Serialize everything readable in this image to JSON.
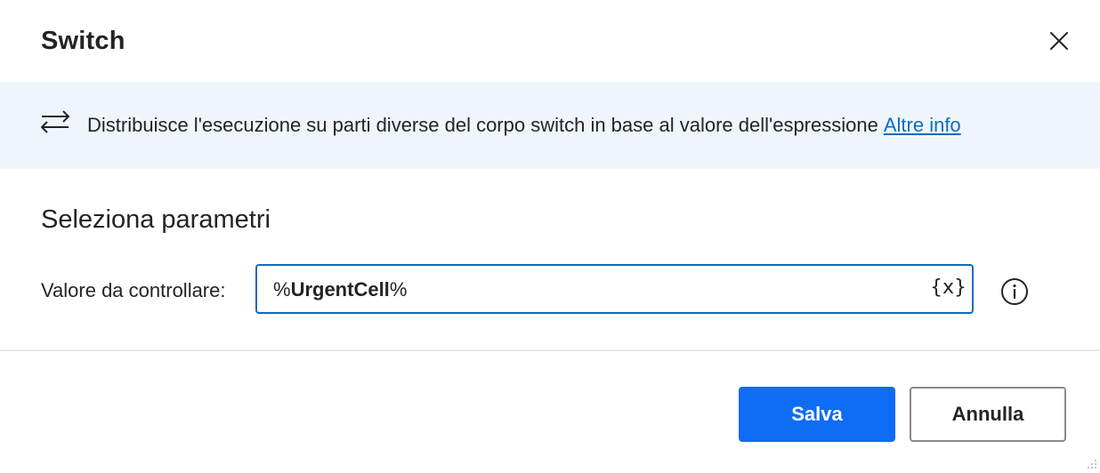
{
  "dialog": {
    "title": "Switch",
    "close_icon": "close-icon"
  },
  "banner": {
    "icon": "swap-arrows-icon",
    "description": "Distribuisce l'esecuzione su parti diverse del corpo switch in base al valore dell'espressione",
    "link_label": "Altre info"
  },
  "parameters": {
    "section_title": "Seleziona parametri",
    "value_field": {
      "label": "Valore da controllare:",
      "value_prefix": "%",
      "value_var": "UrgentCell",
      "value_suffix": "%",
      "variable_button": "{x}",
      "info_icon": "info-icon"
    }
  },
  "footer": {
    "save_label": "Salva",
    "cancel_label": "Annulla"
  },
  "colors": {
    "accent": "#0f6cf5",
    "link": "#0f6cbd",
    "banner_bg": "#f0f5fc",
    "input_border": "#0f6cbd"
  }
}
